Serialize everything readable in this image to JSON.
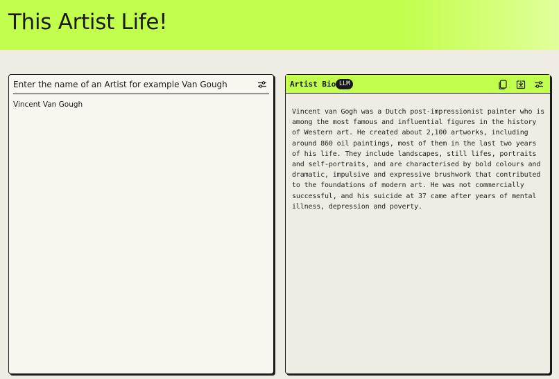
{
  "header": {
    "title": "This Artist Life!"
  },
  "left_panel": {
    "input_label": "Enter the name of an Artist for example Van Gough",
    "input_value": "Vincent Van Gough",
    "settings_icon": "sliders-icon"
  },
  "right_panel": {
    "title": "Artist Bio",
    "badge": "LLM",
    "icons": [
      "copy-icon",
      "download-icon",
      "sliders-icon"
    ],
    "bio_text": "Vincent van Gogh was a Dutch post-impressionist painter who is among the most famous and influential figures in the history of Western art. He created about 2,100 artworks, including around 860 oil paintings, most of them in the last two years of his life. They include landscapes, still lifes, portraits and self-portraits, and are characterised by bold colours and dramatic, impulsive and expressive brushwork that contributed to the foundations of modern art. He was not commercially successful, and his suicide at 37 came after years of mental illness, depression and poverty."
  },
  "colors": {
    "accent": "#c2fe4e",
    "background": "#efede3",
    "panel": "#f7f6ef",
    "border": "#1a1a1a"
  }
}
